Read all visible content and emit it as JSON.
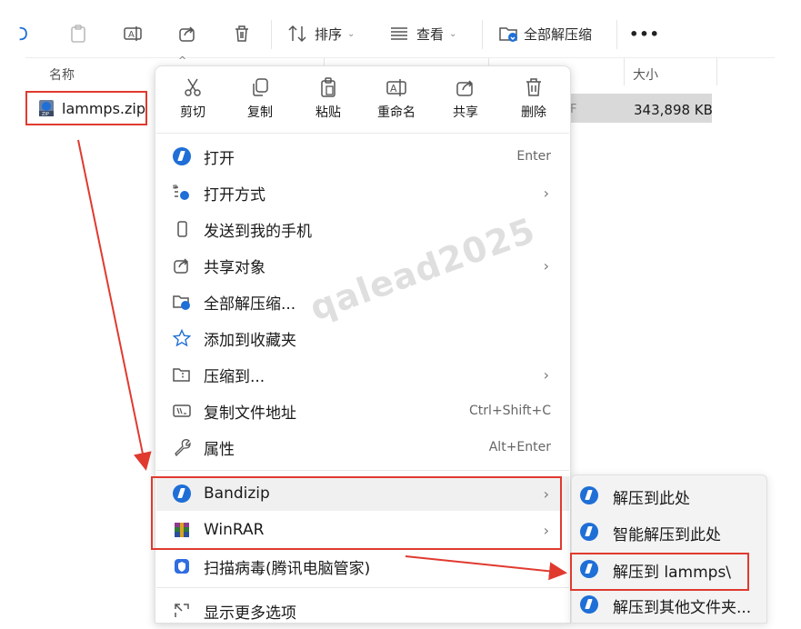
{
  "toolbar": {
    "sort_label": "排序",
    "view_label": "查看",
    "extract_all_label": "全部解压缩",
    "more_label": "•••"
  },
  "columns": {
    "name": "名称",
    "size": "大小"
  },
  "file": {
    "name": "lammps.zip",
    "size": "343,898 KB"
  },
  "quick_actions": [
    {
      "label": "剪切",
      "icon": "scissors-icon"
    },
    {
      "label": "复制",
      "icon": "copy-icon"
    },
    {
      "label": "粘贴",
      "icon": "paste-icon"
    },
    {
      "label": "重命名",
      "icon": "rename-icon"
    },
    {
      "label": "共享",
      "icon": "share-icon"
    },
    {
      "label": "删除",
      "icon": "trash-icon"
    }
  ],
  "menu_items": [
    {
      "label": "打开",
      "shortcut": "Enter",
      "icon": "bandizip-icon"
    },
    {
      "label": "打开方式",
      "shortcut": "",
      "icon": "open-with-icon",
      "submenu": true
    },
    {
      "label": "发送到我的手机",
      "shortcut": "",
      "icon": "phone-icon"
    },
    {
      "label": "共享对象",
      "shortcut": "",
      "icon": "share-icon",
      "submenu": true
    },
    {
      "label": "全部解压缩...",
      "shortcut": "",
      "icon": "extract-folder-icon"
    },
    {
      "label": "添加到收藏夹",
      "shortcut": "",
      "icon": "star-icon"
    },
    {
      "label": "压缩到...",
      "shortcut": "",
      "icon": "compress-icon",
      "submenu": true
    },
    {
      "label": "复制文件地址",
      "shortcut": "Ctrl+Shift+C",
      "icon": "copy-path-icon"
    },
    {
      "label": "属性",
      "shortcut": "Alt+Enter",
      "icon": "wrench-icon"
    },
    {
      "label": "Bandizip",
      "shortcut": "",
      "icon": "bandizip-icon",
      "submenu": true
    },
    {
      "label": "WinRAR",
      "shortcut": "",
      "icon": "winrar-icon",
      "submenu": true
    },
    {
      "label": "扫描病毒(腾讯电脑管家)",
      "shortcut": "",
      "icon": "shield-icon"
    },
    {
      "label": "显示更多选项",
      "shortcut": "",
      "icon": "more-options-icon"
    }
  ],
  "submenu_items": [
    {
      "label": "解压到此处"
    },
    {
      "label": "智能解压到此处"
    },
    {
      "label": "解压到 lammps\\"
    },
    {
      "label": "解压到其他文件夹..."
    }
  ],
  "watermark": "qalead2025",
  "colors": {
    "highlight": "#e03a2f",
    "bandizip_blue": "#1f6fd6"
  }
}
